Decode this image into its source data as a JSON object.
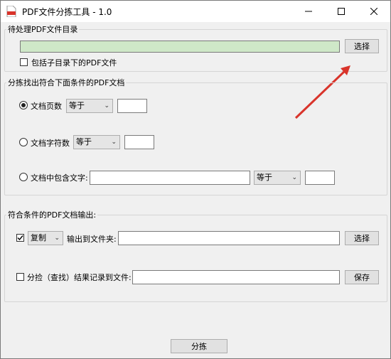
{
  "window": {
    "title": "PDF文件分拣工具 - 1.0"
  },
  "source": {
    "group_label": "待处理PDF文件目录",
    "path_value": "",
    "browse_label": "选择",
    "include_subdirs_label": "包括子目录下的PDF文件",
    "include_subdirs_checked": false
  },
  "criteria": {
    "group_label": "分拣找出符合下面条件的PDF文档",
    "page_count": {
      "label": "文档页数",
      "selected": true,
      "operator": "等于",
      "value": ""
    },
    "char_count": {
      "label": "文档字符数",
      "selected": false,
      "operator": "等于",
      "value": ""
    },
    "contains_text": {
      "label": "文档中包含文字:",
      "selected": false,
      "text": "",
      "operator": "等于",
      "value": ""
    }
  },
  "output": {
    "group_label": "符合条件的PDF文档输出:",
    "action_checked": true,
    "action": "复制",
    "folder_label": "输出到文件夹:",
    "folder_value": "",
    "folder_button": "选择",
    "log_checked": false,
    "log_label": "分捡（查找）结果记录到文件:",
    "log_value": "",
    "save_button": "保存"
  },
  "run_button": "分拣"
}
